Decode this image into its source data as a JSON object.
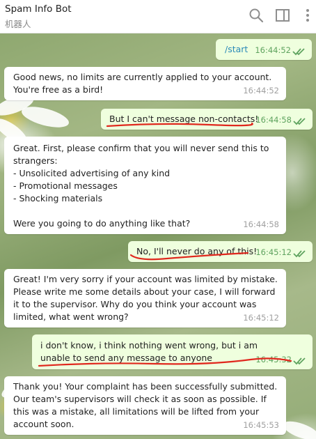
{
  "header": {
    "title": "Spam Info Bot",
    "subtitle": "机器人"
  },
  "messages": [
    {
      "dir": "out",
      "text": "/start",
      "time": "16:44:52"
    },
    {
      "dir": "in",
      "text": "Good news, no limits are currently applied to your account. You're free as a bird!",
      "time": "16:44:52"
    },
    {
      "dir": "out",
      "text": "But I can't message non-contacts!",
      "time": "16:44:58"
    },
    {
      "dir": "in",
      "text": "Great. First, please confirm that you will never send this to strangers:\n- Unsolicited advertising of any kind\n- Promotional messages\n- Shocking materials\n\nWere you going to do anything like that?",
      "time": "16:44:58"
    },
    {
      "dir": "out",
      "text": "No, I'll never do any of this!",
      "time": "16:45:12"
    },
    {
      "dir": "in",
      "text": "Great! I'm very sorry if your account was limited by mistake. Please write me some details about your case, I will forward it to the supervisor. Why do you think your account was limited, what went wrong?",
      "time": "16:45:12"
    },
    {
      "dir": "out",
      "text": "i don't know, i think nothing went wrong, but i am unable to send any message to anyone",
      "time": "16:45:32"
    },
    {
      "dir": "in",
      "text": "Thank you! Your complaint has been successfully submitted. Our team's supervisors will check it as soon as possible. If this was a mistake, all limitations will be lifted from your account soon.",
      "time": "16:45:53"
    }
  ],
  "colors": {
    "incoming_bubble": "#ffffff",
    "outgoing_bubble": "#efffde",
    "outgoing_time": "#5fa35f",
    "annotation": "#e0281e"
  },
  "icons": [
    "search-icon",
    "sidebar-toggle-icon",
    "more-options-icon",
    "double-check-icon"
  ]
}
